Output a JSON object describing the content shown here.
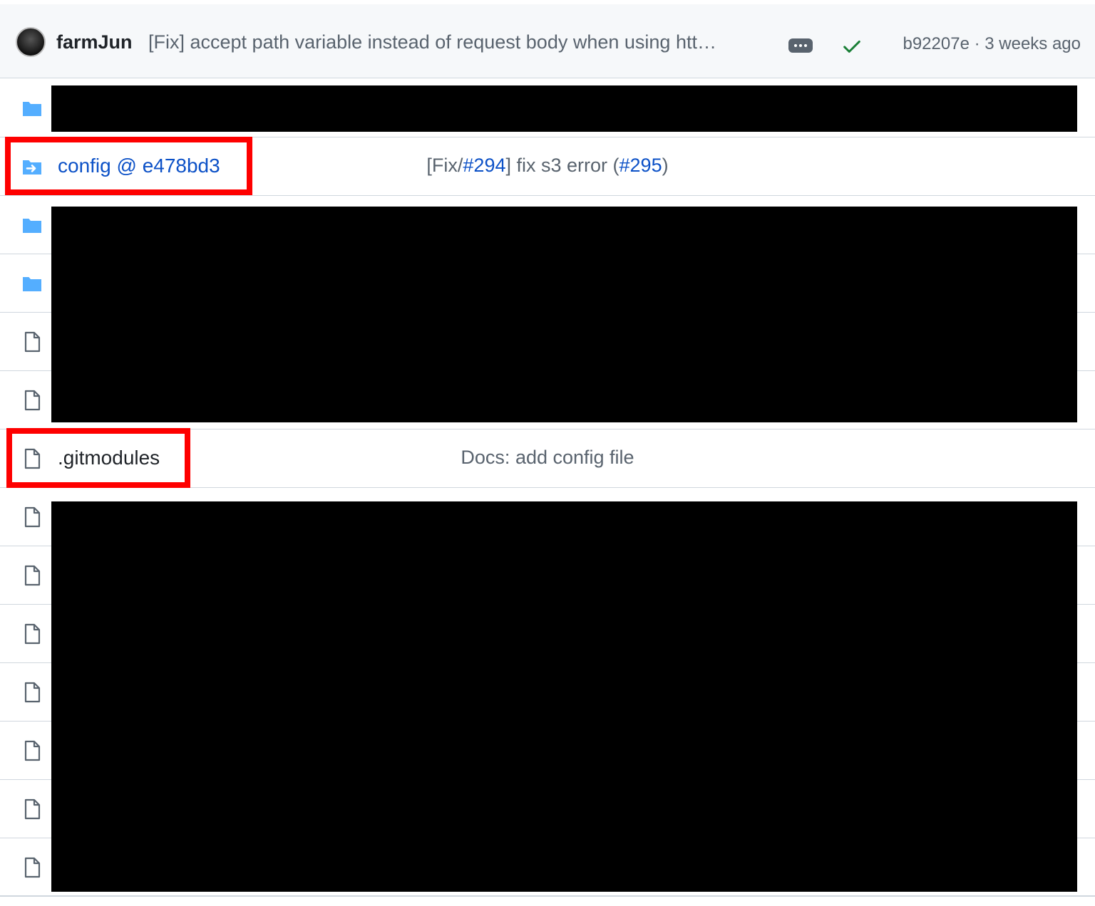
{
  "commit": {
    "author": "farmJun",
    "message": "[Fix] accept path variable instead of request body when using htt…",
    "sha_time": "b92207e · 3 weeks ago",
    "status_icon": "check-icon",
    "status_color": "#1a7f37"
  },
  "rows": [
    {
      "type": "folder",
      "icon": "folder-icon"
    },
    {
      "type": "submodule",
      "icon": "submodule-icon",
      "name": "config @ e478bd3",
      "message": {
        "prefix": "[Fix/",
        "issue_link": "#294",
        "middle": "] fix s3 error (",
        "pr_link": "#295",
        "suffix": ")"
      }
    },
    {
      "type": "folder",
      "icon": "folder-icon"
    },
    {
      "type": "folder",
      "icon": "folder-icon"
    },
    {
      "type": "file",
      "icon": "file-icon"
    },
    {
      "type": "file",
      "icon": "file-icon"
    },
    {
      "type": "file",
      "icon": "file-icon",
      "name": ".gitmodules",
      "message": "Docs: add config file"
    },
    {
      "type": "file",
      "icon": "file-icon"
    },
    {
      "type": "file",
      "icon": "file-icon"
    },
    {
      "type": "file",
      "icon": "file-icon"
    },
    {
      "type": "file",
      "icon": "file-icon"
    },
    {
      "type": "file",
      "icon": "file-icon"
    },
    {
      "type": "file",
      "icon": "file-icon"
    },
    {
      "type": "file",
      "icon": "file-icon"
    }
  ],
  "colors": {
    "link": "#0c51c7",
    "folder": "#54aeff",
    "highlight": "#fe0000"
  }
}
